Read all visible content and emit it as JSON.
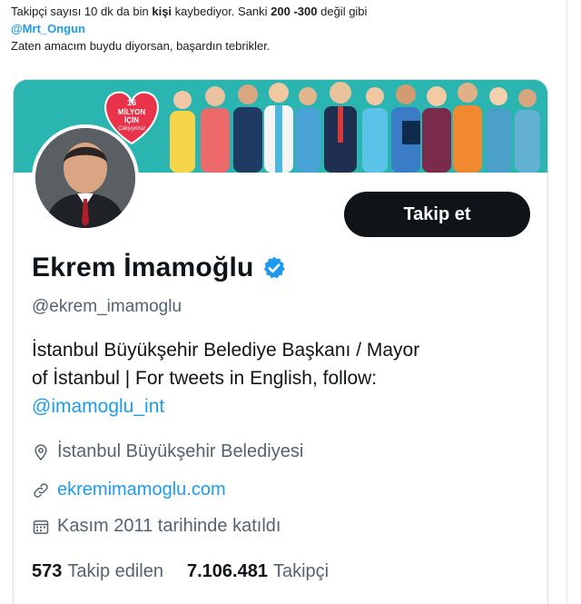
{
  "tweet": {
    "line1_a": "Takipçi sayısı 10 dk da bin ",
    "line1_b": "kişi",
    "line1_c": " kaybediyor. Sanki ",
    "line1_d": "200 -300",
    "line1_e": " değil gibi",
    "mention": "@Mrt_Ongun",
    "line3": "Zaten amacım buydu diyorsan, başardın tebrikler."
  },
  "banner": {
    "badge_line1": "16",
    "badge_line2": "MİLYON",
    "badge_line3": "İÇİN",
    "badge_line4": "Çalışıyoruz"
  },
  "profile": {
    "follow_label": "Takip et",
    "name": "Ekrem İmamoğlu",
    "handle": "@ekrem_imamoglu",
    "bio_line1": "İstanbul Büyükşehir Belediye Başkanı / Mayor",
    "bio_line2": "of İstanbul | For tweets in English, follow:",
    "bio_link": "@imamoglu_int",
    "location": "İstanbul Büyükşehir Belediyesi",
    "url": "ekremimamoglu.com",
    "joined": "Kasım 2011 tarihinde katıldı",
    "following_count": "573",
    "following_label": "Takip edilen",
    "followers_count": "7.106.481",
    "followers_label": "Takipçi"
  },
  "colors": {
    "accent": "#1d9bf0",
    "banner_bg": "#2bb5b0",
    "badge": "#e8334a",
    "button_bg": "#0f1419"
  }
}
